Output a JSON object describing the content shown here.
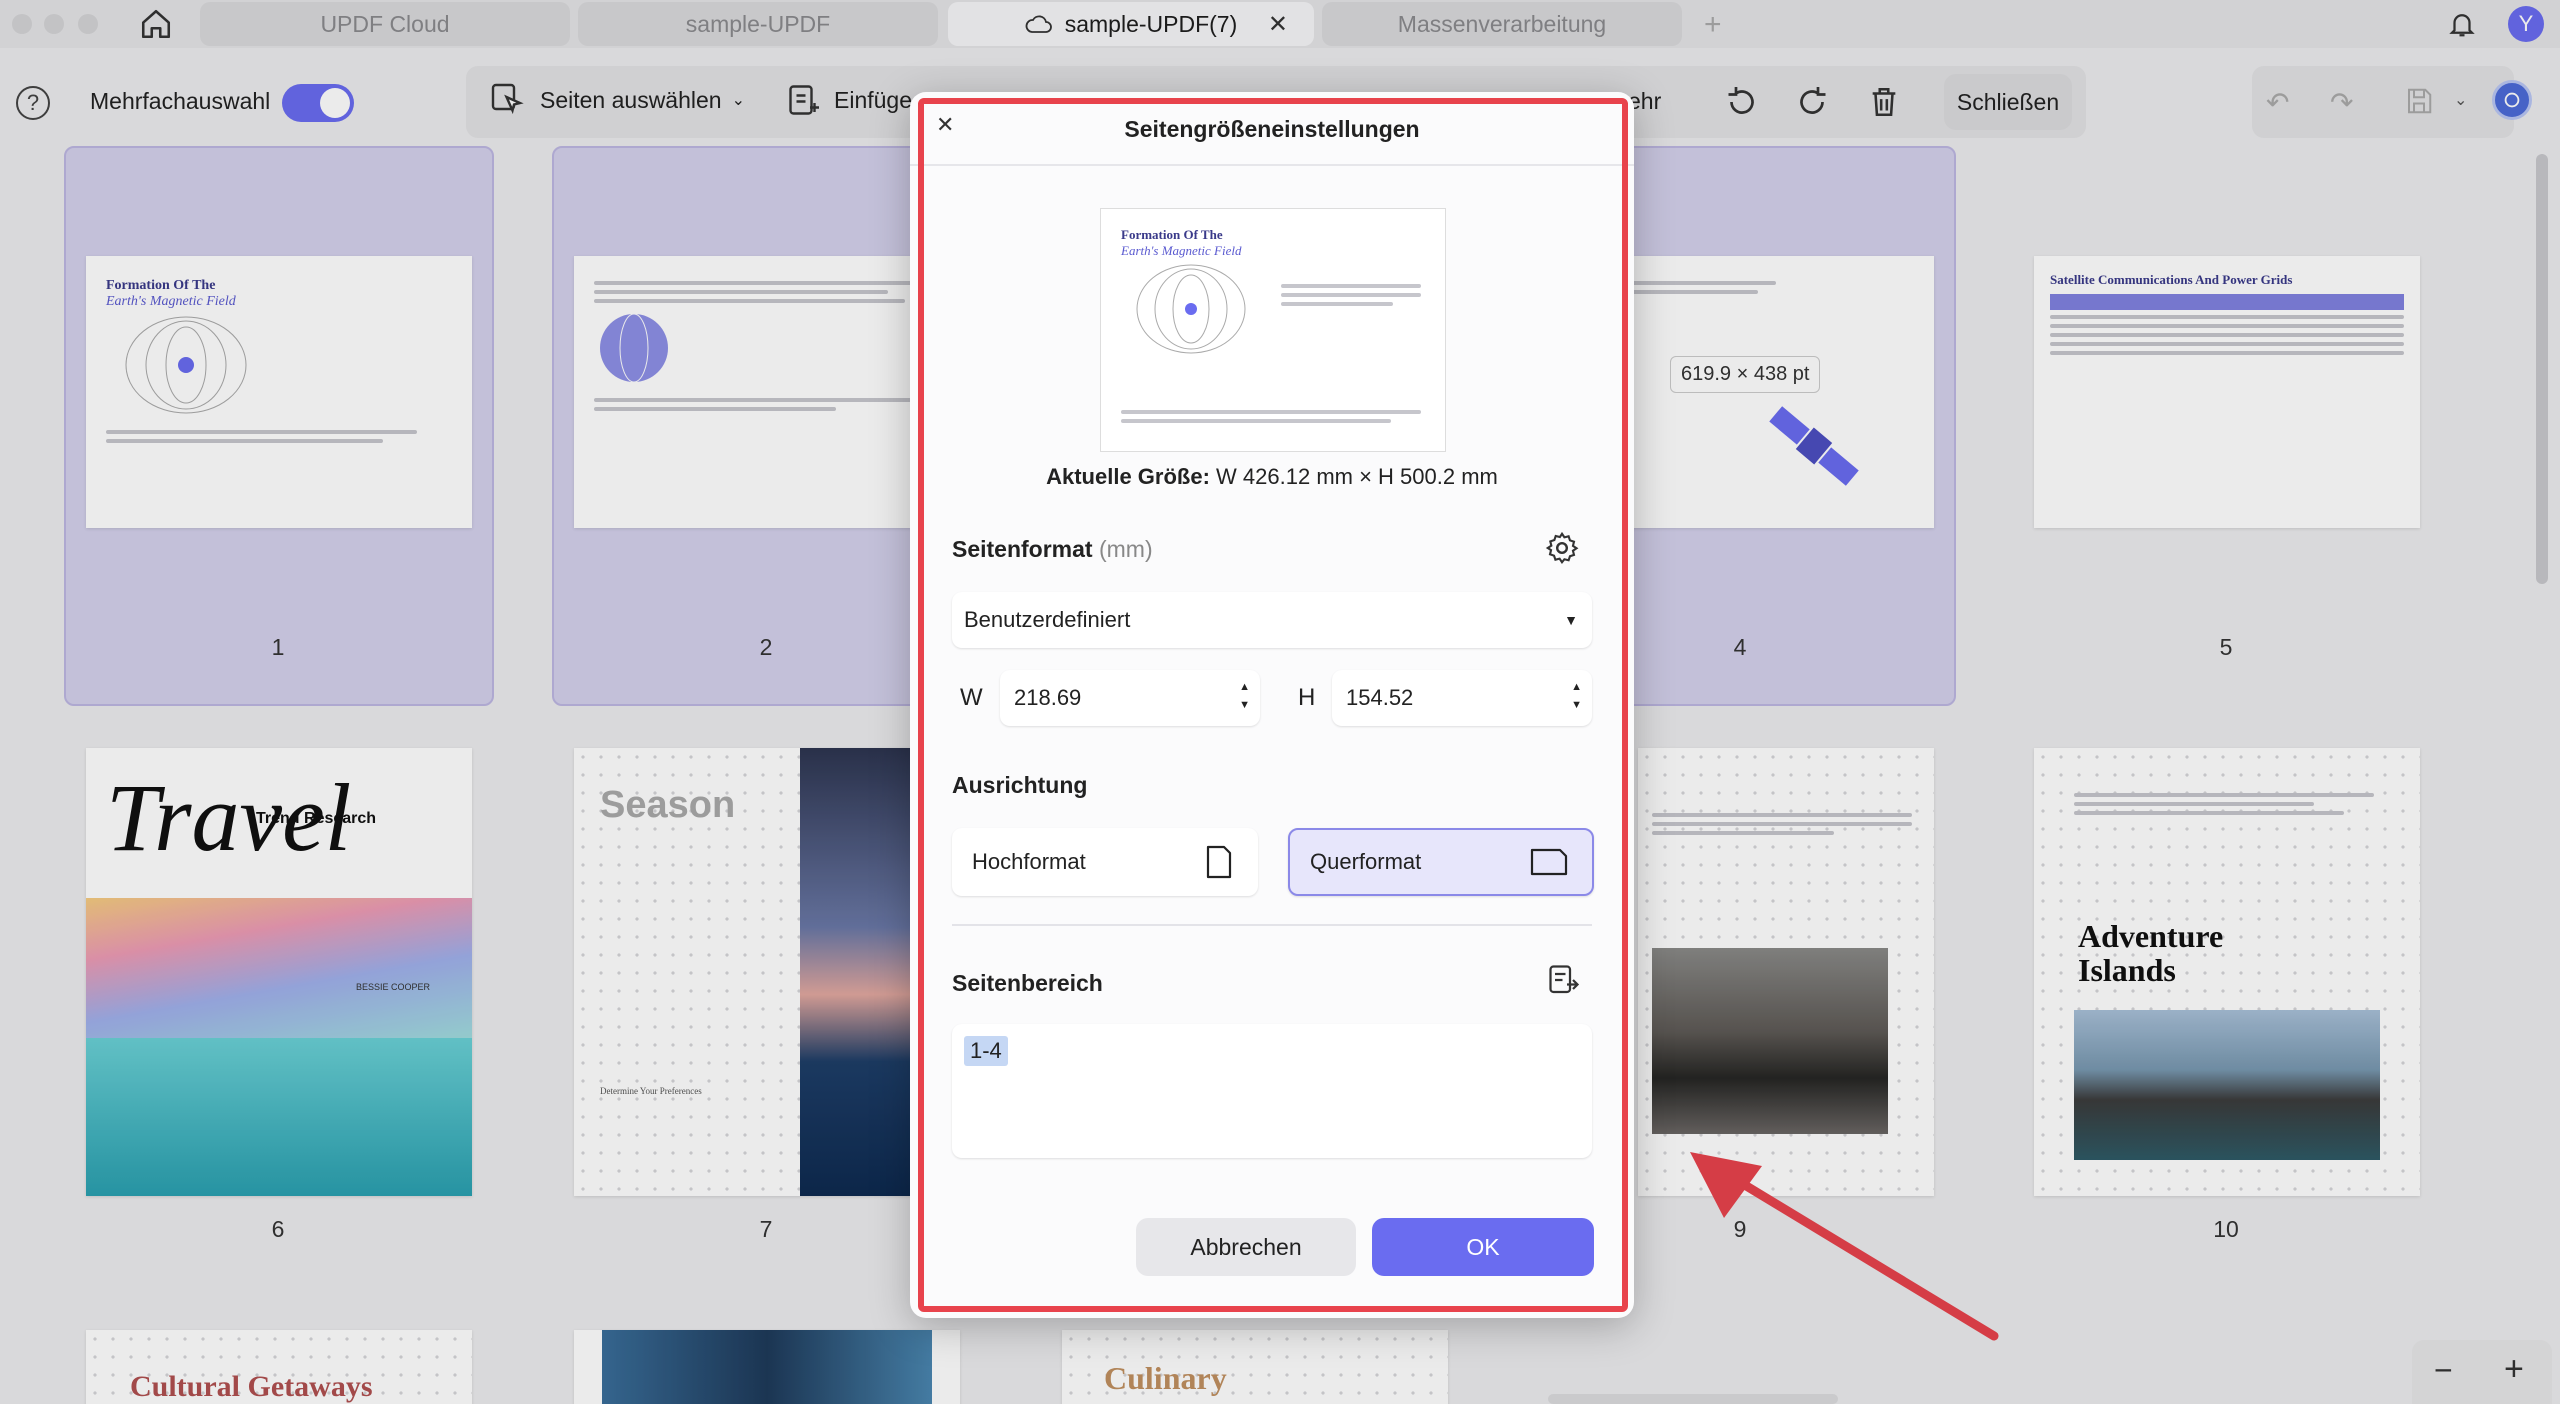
{
  "tabs": [
    {
      "label": "UPDF Cloud",
      "active": false
    },
    {
      "label": "sample-UPDF",
      "active": false
    },
    {
      "label": "sample-UPDF(7)",
      "active": true
    },
    {
      "label": "Massenverarbeitung",
      "active": false
    }
  ],
  "account": {
    "avatar_letter": "Y"
  },
  "toolbar": {
    "multi_select_label": "Mehrfachauswahl",
    "multi_select_on": true,
    "select_pages_label": "Seiten auswählen",
    "insert_label": "Einfüge",
    "more_label": "ehr",
    "close_label": "Schließen"
  },
  "pages": {
    "page1": {
      "number": "1",
      "title_line1": "Formation Of The",
      "title_line2": "Earth's Magnetic Field"
    },
    "page2": {
      "number": "2"
    },
    "page4": {
      "number": "4"
    },
    "page5": {
      "number": "5",
      "title": "Satellite Communications And Power Grids"
    },
    "page6": {
      "number": "6",
      "title": "Travel",
      "subtitle": "Trend Research",
      "author": "BESSIE COOPER"
    },
    "page7": {
      "number": "7",
      "title": "Season",
      "subtitle": "Determine Your Preferences"
    },
    "page9": {
      "number": "9"
    },
    "page10": {
      "number": "10",
      "title_line1": "Adventure",
      "title_line2": "Islands"
    },
    "page11": {
      "title": "Cultural Getaways"
    },
    "page13": {
      "title": "Culinary"
    }
  },
  "size_tooltip": "619.9 × 438 pt",
  "dialog": {
    "title": "Seitengrößeneinstellungen",
    "preview_title_line1": "Formation Of The",
    "preview_title_line2": "Earth's Magnetic Field",
    "current_size_label": "Aktuelle Größe:",
    "current_size_value": "W 426.12 mm × H 500.2 mm",
    "page_format_label": "Seitenformat",
    "page_format_unit": "(mm)",
    "format_selected": "Benutzerdefiniert",
    "width_label": "W",
    "width_value": "218.69",
    "height_label": "H",
    "height_value": "154.52",
    "orientation_label": "Ausrichtung",
    "portrait_label": "Hochformat",
    "landscape_label": "Querformat",
    "selected_orientation": "landscape",
    "page_range_label": "Seitenbereich",
    "page_range_value": "1-4",
    "cancel_label": "Abbrechen",
    "ok_label": "OK"
  },
  "colors": {
    "accent": "#6a6cf0",
    "selection": "#d4d1ec",
    "annotation_red": "#e8434c"
  }
}
